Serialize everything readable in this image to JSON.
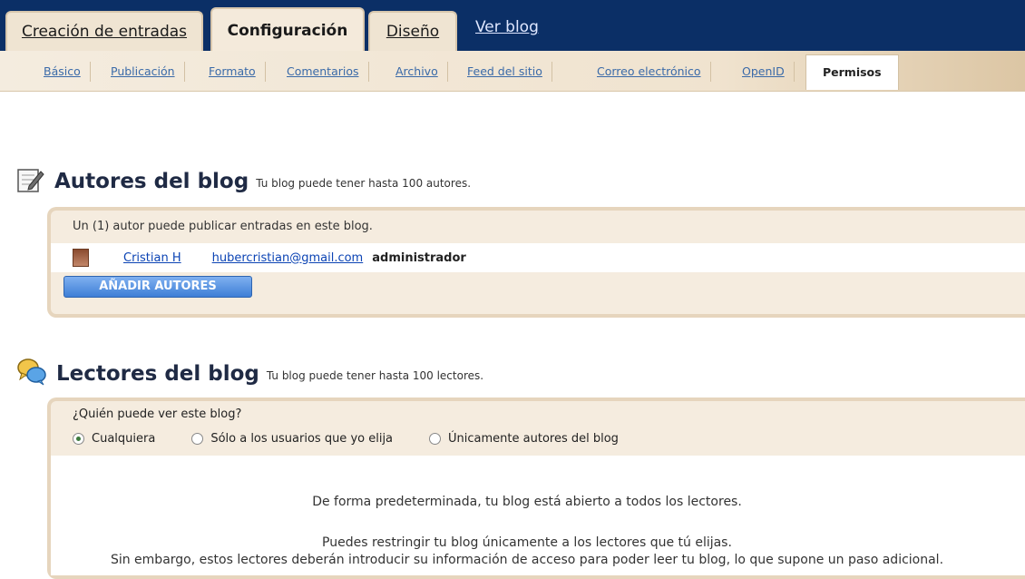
{
  "top_tabs": {
    "creation": "Creación de entradas",
    "config": "Configuración",
    "design": "Diseño",
    "view_blog": "Ver blog"
  },
  "sub_tabs": [
    "Básico",
    "Publicación",
    "Formato",
    "Comentarios",
    "Archivo",
    "Feed del sitio",
    "Correo electrónico",
    "OpenID",
    "Permisos"
  ],
  "authors": {
    "title": "Autores del blog",
    "note": "Tu blog puede tener hasta 100 autores.",
    "count_line": "Un (1) autor puede publicar entradas en este blog.",
    "author_name": "Cristian H",
    "author_email": "hubercristian@gmail.com",
    "author_role": "administrador",
    "add_button": "AÑADIR AUTORES"
  },
  "readers": {
    "title": "Lectores del blog",
    "note": "Tu blog puede tener hasta 100 lectores.",
    "question": "¿Quién puede ver este blog?",
    "option1": "Cualquiera",
    "option2": "Sólo a los usuarios que yo elija",
    "option3": "Únicamente autores del blog",
    "selected": "Cualquiera",
    "info1": "De forma predeterminada, tu blog está abierto a todos los lectores.",
    "info2": "Puedes restringir tu blog únicamente a los lectores que tú elijas.",
    "info3": "Sin embargo, estos lectores deberán introducir su información de acceso para poder leer tu blog, lo que supone un paso adicional."
  }
}
